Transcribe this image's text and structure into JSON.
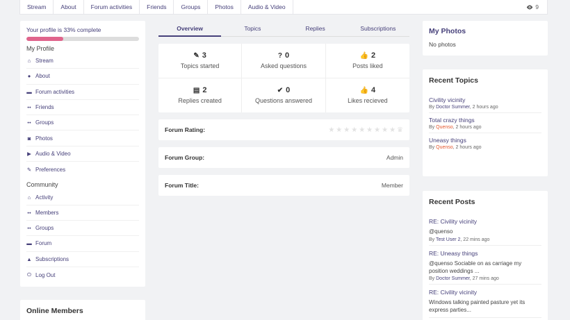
{
  "topnav": {
    "tabs": [
      "Stream",
      "About",
      "Forum activities",
      "Friends",
      "Groups",
      "Photos",
      "Audio & Video"
    ],
    "views": "9"
  },
  "profile": {
    "progress_text": "Your profile is 33% complete",
    "progress_fraction": 0.33,
    "progress_color": "#e0648c",
    "my_profile_title": "My Profile",
    "my_profile_items": [
      {
        "label": "Stream",
        "icon": "home-icon"
      },
      {
        "label": "About",
        "icon": "user-icon"
      },
      {
        "label": "Forum activities",
        "icon": "comments-icon"
      },
      {
        "label": "Friends",
        "icon": "users-icon"
      },
      {
        "label": "Groups",
        "icon": "group-icon"
      },
      {
        "label": "Photos",
        "icon": "camera-icon"
      },
      {
        "label": "Audio & Video",
        "icon": "video-icon"
      },
      {
        "label": "Preferences",
        "icon": "edit-icon"
      }
    ],
    "community_title": "Community",
    "community_items": [
      {
        "label": "Activity",
        "icon": "home-icon"
      },
      {
        "label": "Members",
        "icon": "users-icon"
      },
      {
        "label": "Groups",
        "icon": "group-icon"
      },
      {
        "label": "Forum",
        "icon": "comments-icon"
      },
      {
        "label": "Subscriptions",
        "icon": "bell-icon"
      },
      {
        "label": "Log Out",
        "icon": "power-icon"
      }
    ]
  },
  "online_members": {
    "title": "Online Members"
  },
  "main_tabs": [
    "Overview",
    "Topics",
    "Replies",
    "Subscriptions"
  ],
  "stats": [
    {
      "value": "3",
      "label": "Topics started",
      "icon": "pencil-icon"
    },
    {
      "value": "0",
      "label": "Asked questions",
      "icon": "question-icon"
    },
    {
      "value": "2",
      "label": "Posts liked",
      "icon": "thumbs-up-icon"
    },
    {
      "value": "2",
      "label": "Replies created",
      "icon": "file-icon"
    },
    {
      "value": "0",
      "label": "Questions answered",
      "icon": "check-icon"
    },
    {
      "value": "4",
      "label": "Likes recieved",
      "icon": "thumbs-up-icon"
    }
  ],
  "forum_info": {
    "rating_label": "Forum Rating:",
    "rating_icons": 10,
    "group_label": "Forum Group:",
    "group_value": "Admin",
    "title_label": "Forum Title:",
    "title_value": "Member"
  },
  "my_photos": {
    "title": "My Photos",
    "empty_text": "No photos"
  },
  "recent_topics": {
    "title": "Recent Topics",
    "items": [
      {
        "title": "Civility vicinity",
        "by": "By",
        "author": "Doctor Summer",
        "time": ", 2 hours ago"
      },
      {
        "title": "Total crazy things",
        "by": "By",
        "author": "Quenso",
        "time": ", 2 hours ago"
      },
      {
        "title": "Uneasy things",
        "by": "By",
        "author": "Quenso",
        "time": ", 2 hours ago"
      }
    ]
  },
  "recent_posts": {
    "title": "Recent Posts",
    "items": [
      {
        "title": "RE: Civility vicinity",
        "body": "@quenso",
        "by": "By",
        "author": "Test User 2",
        "time": ", 22 mins ago"
      },
      {
        "title": "RE: Uneasy things",
        "body": "@quenso Sociable on as carriage my position weddings ...",
        "by": "By",
        "author": "Doctor Summer",
        "time": ", 27 mins ago"
      },
      {
        "title": "RE: Civility vicinity",
        "body": "Windows talking painted pasture yet its express parties...",
        "by": "",
        "author": "",
        "time": ""
      }
    ]
  }
}
